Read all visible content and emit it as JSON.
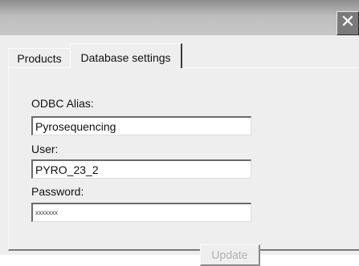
{
  "window": {
    "close_glyph": "✕"
  },
  "tabs": [
    {
      "label": "Products",
      "selected": false
    },
    {
      "label": "Database settings",
      "selected": true
    }
  ],
  "form": {
    "odbc_alias": {
      "label": "ODBC Alias:",
      "value": "Pyrosequencing"
    },
    "user": {
      "label": "User:",
      "value": "PYRO_23_2"
    },
    "password": {
      "label": "Password:",
      "value": "xxxxxxx"
    },
    "update_button": {
      "label": "Update",
      "enabled": false
    }
  },
  "colors": {
    "titlebar_dark": "#8d8d8d",
    "titlebar_light": "#c7c7c7",
    "dialog_bg": "#eeeeee",
    "disabled_text": "#a8a8a8"
  }
}
